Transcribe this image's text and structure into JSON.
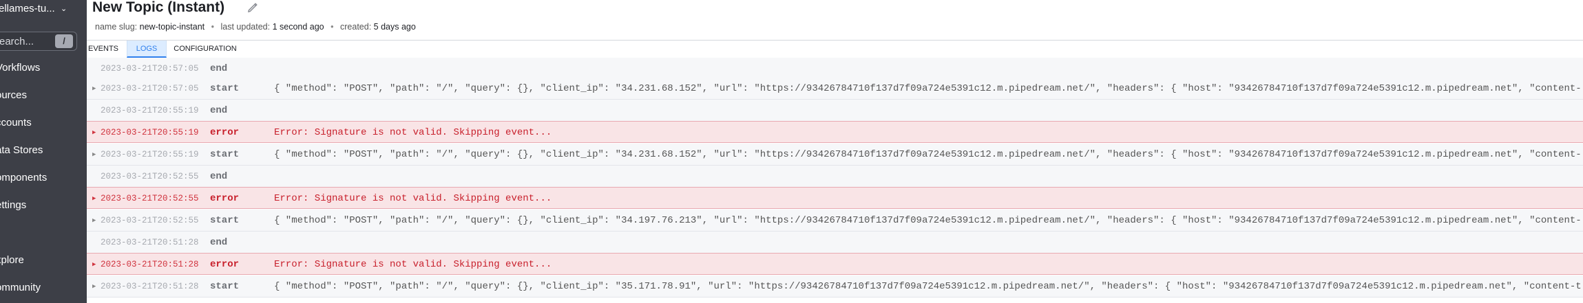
{
  "sidebar": {
    "workspace_name": "ellames-tu...",
    "search_placeholder": "earch...",
    "search_shortcut": "/",
    "items": [
      {
        "label": "Vorkflows"
      },
      {
        "label": "ources"
      },
      {
        "label": "ccounts"
      },
      {
        "label": "ata Stores"
      },
      {
        "label": "omponents"
      },
      {
        "label": "ettings"
      },
      {
        "label": "xplore"
      },
      {
        "label": "ommunity"
      }
    ]
  },
  "header": {
    "title": "New Topic (Instant)",
    "meta": {
      "slug_label": "name slug:",
      "slug_value": "new-topic-instant",
      "updated_label": "last updated:",
      "updated_value": "1 second ago",
      "created_label": "created:",
      "created_value": "5 days ago"
    }
  },
  "tabs": [
    {
      "label": "EVENTS",
      "active": false
    },
    {
      "label": "LOGS",
      "active": true
    },
    {
      "label": "CONFIGURATION",
      "active": false
    }
  ],
  "logs": [
    {
      "ts": "2023-03-21T20:57:05",
      "type": "end",
      "msg": "",
      "expandable": false
    },
    {
      "ts": "2023-03-21T20:57:05",
      "type": "start",
      "msg": "{ \"method\": \"POST\", \"path\": \"/\", \"query\": {}, \"client_ip\": \"34.231.68.152\", \"url\": \"https://93426784710f137d7f09a724e5391c12.m.pipedream.net/\", \"headers\": { \"host\": \"93426784710f137d7f09a724e5391c12.m.pipedream.net\", \"content-",
      "expandable": true
    },
    {
      "ts": "2023-03-21T20:55:19",
      "type": "end",
      "msg": "",
      "expandable": false
    },
    {
      "ts": "2023-03-21T20:55:19",
      "type": "error",
      "msg": "Error: Signature is not valid. Skipping event...",
      "expandable": true
    },
    {
      "ts": "2023-03-21T20:55:19",
      "type": "start",
      "msg": "{ \"method\": \"POST\", \"path\": \"/\", \"query\": {}, \"client_ip\": \"34.231.68.152\", \"url\": \"https://93426784710f137d7f09a724e5391c12.m.pipedream.net/\", \"headers\": { \"host\": \"93426784710f137d7f09a724e5391c12.m.pipedream.net\", \"content-",
      "expandable": true
    },
    {
      "ts": "2023-03-21T20:52:55",
      "type": "end",
      "msg": "",
      "expandable": false
    },
    {
      "ts": "2023-03-21T20:52:55",
      "type": "error",
      "msg": "Error: Signature is not valid. Skipping event...",
      "expandable": true
    },
    {
      "ts": "2023-03-21T20:52:55",
      "type": "start",
      "msg": "{ \"method\": \"POST\", \"path\": \"/\", \"query\": {}, \"client_ip\": \"34.197.76.213\", \"url\": \"https://93426784710f137d7f09a724e5391c12.m.pipedream.net/\", \"headers\": { \"host\": \"93426784710f137d7f09a724e5391c12.m.pipedream.net\", \"content-",
      "expandable": true
    },
    {
      "ts": "2023-03-21T20:51:28",
      "type": "end",
      "msg": "",
      "expandable": false
    },
    {
      "ts": "2023-03-21T20:51:28",
      "type": "error",
      "msg": "Error: Signature is not valid. Skipping event...",
      "expandable": true
    },
    {
      "ts": "2023-03-21T20:51:28",
      "type": "start",
      "msg": "{ \"method\": \"POST\", \"path\": \"/\", \"query\": {}, \"client_ip\": \"35.171.78.91\", \"url\": \"https://93426784710f137d7f09a724e5391c12.m.pipedream.net/\", \"headers\": { \"host\": \"93426784710f137d7f09a724e5391c12.m.pipedream.net\", \"content-t",
      "expandable": true
    }
  ]
}
